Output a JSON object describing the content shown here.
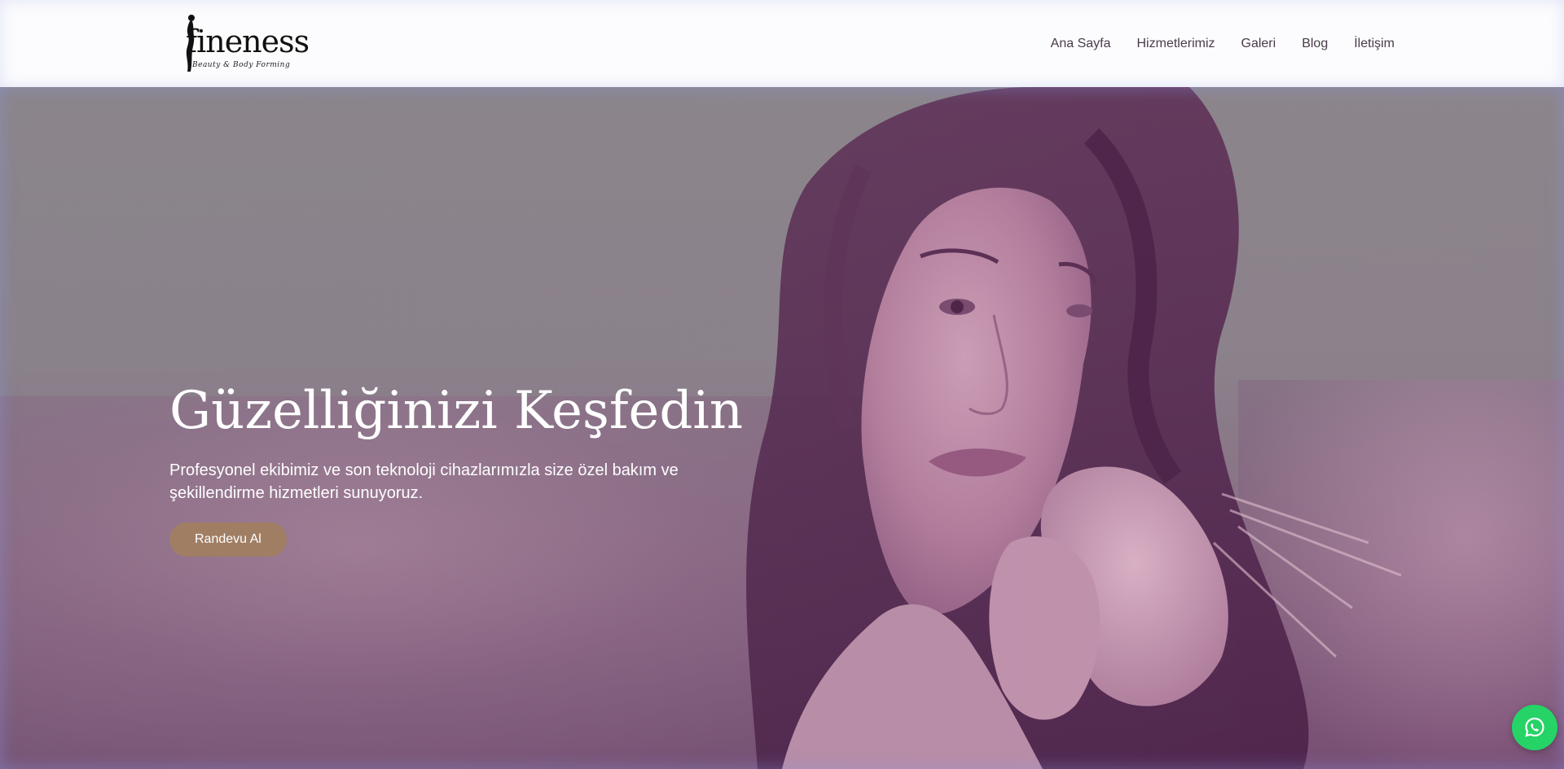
{
  "header": {
    "logo": {
      "word": "fineness",
      "tagline": "Beauty & Body Forming"
    },
    "nav": [
      {
        "label": "Ana Sayfa"
      },
      {
        "label": "Hizmetlerimiz"
      },
      {
        "label": "Galeri"
      },
      {
        "label": "Blog"
      },
      {
        "label": "İletişim"
      }
    ]
  },
  "hero": {
    "title": "Güzelliğinizi Keşfedin",
    "subtitle": "Profesyonel ekibimiz ve son teknoloji cihazlarımızla size özel bakım ve şekillendirme hizmetleri sunuyoruz.",
    "cta_label": "Randevu Al"
  },
  "floating": {
    "whatsapp_icon": "whatsapp-icon"
  },
  "colors": {
    "cta": "#a07e64",
    "whatsapp": "#25d366",
    "nav_text": "#4a3a4a"
  }
}
